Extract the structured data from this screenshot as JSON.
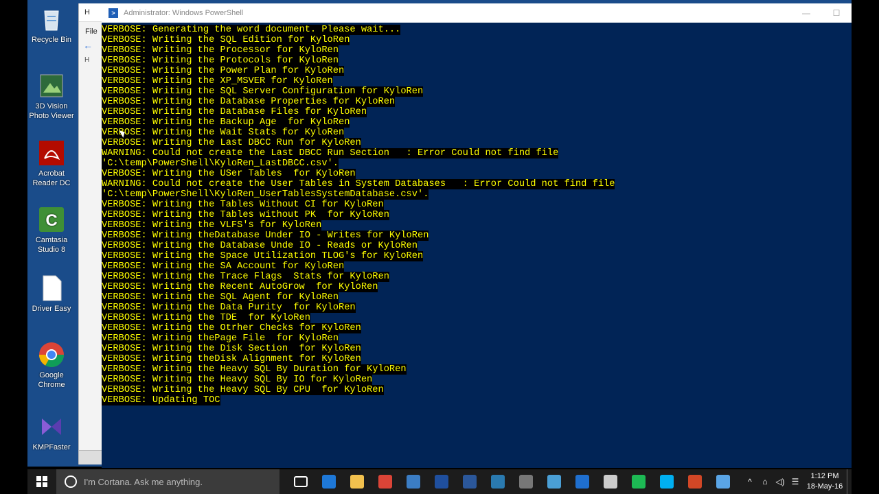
{
  "desktop_icons": [
    {
      "label": "Recycle Bin",
      "icon": "recycle-bin-icon"
    },
    {
      "label": "3D Vision Photo Viewer",
      "icon": "photo-viewer-icon"
    },
    {
      "label": "Acrobat Reader DC",
      "icon": "acrobat-icon"
    },
    {
      "label": "Camtasia Studio 8",
      "icon": "camtasia-icon"
    },
    {
      "label": "Driver Easy",
      "icon": "file-icon"
    },
    {
      "label": "Google Chrome",
      "icon": "chrome-icon"
    },
    {
      "label": "KMPFaster",
      "icon": "kmp-icon"
    }
  ],
  "explorer": {
    "title": "H",
    "menu": "File",
    "tree": "H"
  },
  "powershell": {
    "title": "Administrator: Windows PowerShell",
    "minimize": "—",
    "maximize": "☐",
    "lines": [
      "VERBOSE: Generating the word document. Please wait...",
      "VERBOSE: Writing the SQL Edition for KyloRen",
      "VERBOSE: Writing the Processor for KyloRen",
      "VERBOSE: Writing the Protocols for KyloRen",
      "VERBOSE: Writing the Power Plan for KyloRen",
      "VERBOSE: Writing the XP_MSVER for KyloRen",
      "VERBOSE: Writing the SQL Server Configuration for KyloRen",
      "VERBOSE: Writing the Database Properties for KyloRen",
      "VERBOSE: Writing the Database Files for KyloRen",
      "VERBOSE: Writing the Backup Age  for KyloRen",
      "VERBOSE: Writing the Wait Stats for KyloRen",
      "VERBOSE: Writing the Last DBCC Run for KyloRen",
      "WARNING: Could not create the Last DBCC Run Section   : Error Could not find file",
      "'C:\\temp\\PowerShell\\KyloRen_LastDBCC.csv'.",
      "VERBOSE: Writing the USer Tables  for KyloRen",
      "WARNING: Could not create the User Tables in System Databases   : Error Could not find file",
      "'C:\\temp\\PowerShell\\KyloRen_UserTablesSystemDatabase.csv'.",
      "VERBOSE: Writing the Tables Without CI for KyloRen",
      "VERBOSE: Writing the Tables without PK  for KyloRen",
      "VERBOSE: Writing the VLFS's for KyloRen",
      "VERBOSE: Writing theDatabase Under IO - Writes for KyloRen",
      "VERBOSE: Writing the Database Unde IO - Reads or KyloRen",
      "VERBOSE: Writing the Space Utilization TLOG's for KyloRen",
      "VERBOSE: Writing the SA Account for KyloRen",
      "VERBOSE: Writing the Trace Flags  Stats for KyloRen",
      "VERBOSE: Writing the Recent AutoGrow  for KyloRen",
      "VERBOSE: Writing the SQL Agent for KyloRen",
      "VERBOSE: Writing the Data Purity  for KyloRen",
      "VERBOSE: Writing the TDE  for KyloRen",
      "VERBOSE: Writing the Otrher Checks for KyloRen",
      "VERBOSE: Writing thePage File  for KyloRen",
      "VERBOSE: Writing the Disk Section  for KyloRen",
      "VERBOSE: Writing theDisk Alignment for KyloRen",
      "VERBOSE: Writing the Heavy SQL By Duration for KyloRen",
      "VERBOSE: Writing the Heavy SQL By IO for KyloRen",
      "VERBOSE: Writing the Heavy SQL By CPU  for KyloRen",
      "VERBOSE: Updating TOC"
    ]
  },
  "taskbar": {
    "cortana_placeholder": "I'm Cortana. Ask me anything.",
    "apps": [
      {
        "icon": "task-view-icon",
        "color": "#1c1c1c"
      },
      {
        "icon": "edge-icon",
        "color": "#1e78d7"
      },
      {
        "icon": "file-explorer-icon",
        "color": "#f2c14e"
      },
      {
        "icon": "chrome-icon",
        "color": "#db4437"
      },
      {
        "icon": "powershell-ise-icon",
        "color": "#3b7dc4"
      },
      {
        "icon": "powershell-icon",
        "color": "#1f4f9e"
      },
      {
        "icon": "word-icon",
        "color": "#2b579a"
      },
      {
        "icon": "sql-icon",
        "color": "#2a7ab0"
      },
      {
        "icon": "tools-icon",
        "color": "#777777"
      },
      {
        "icon": "network-icon",
        "color": "#4a9fd6"
      },
      {
        "icon": "azure-icon",
        "color": "#1f6fcf"
      },
      {
        "icon": "settings-icon",
        "color": "#cccccc"
      },
      {
        "icon": "spotify-icon",
        "color": "#1db954"
      },
      {
        "icon": "skype-icon",
        "color": "#00aff0"
      },
      {
        "icon": "powerpoint-icon",
        "color": "#d24726"
      },
      {
        "icon": "snowflake-icon",
        "color": "#5aa5e6"
      }
    ],
    "tray_symbols": [
      "^",
      "⌂",
      "◁)",
      "☰"
    ],
    "time": "1:12 PM",
    "date": "18-May-16"
  }
}
